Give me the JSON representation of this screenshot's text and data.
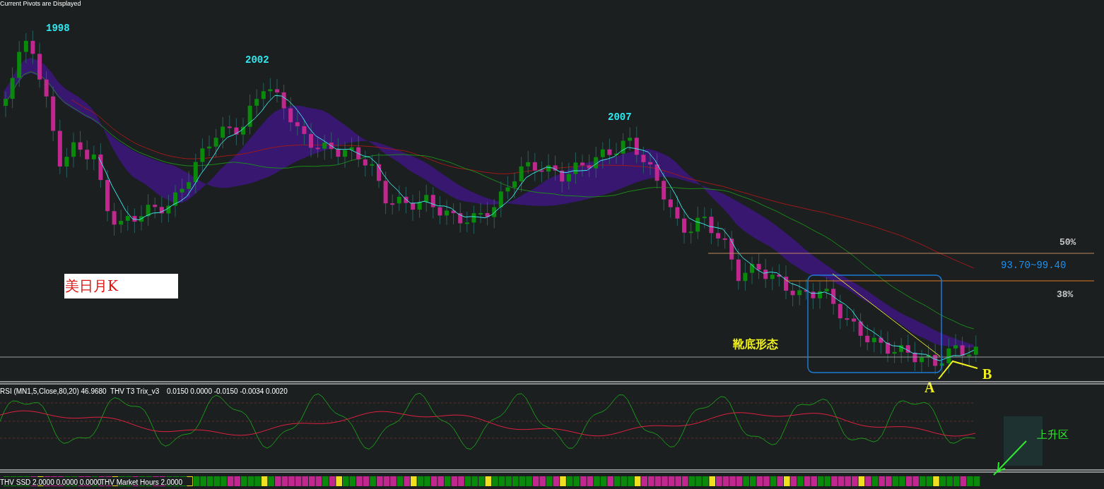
{
  "header": {
    "title": "Current Pivots are Displayed"
  },
  "main_chart": {
    "year_labels": [
      "1998",
      "2002",
      "2007"
    ],
    "caption": "美日月K",
    "pattern_label": "靴底形态",
    "levels": [
      {
        "label": "50%"
      },
      {
        "label": "38%"
      }
    ],
    "target_range": "93.70~99.40",
    "point_labels": [
      "A",
      "B"
    ]
  },
  "rsi_panel": {
    "legend": "RSI (MN1,5,Close,80,20) 46.9680",
    "trix_legend": "THV T3 Trix_v3",
    "trix_values": "0.0150 0.0000 -0.0150 -0.0034 0.0020",
    "zone_label": "上升区"
  },
  "ssd_panel": {
    "legend": "THV SSD 2.0000 0.0000 0.0000",
    "market_hours": "THV Market Hours 2.0000"
  }
}
